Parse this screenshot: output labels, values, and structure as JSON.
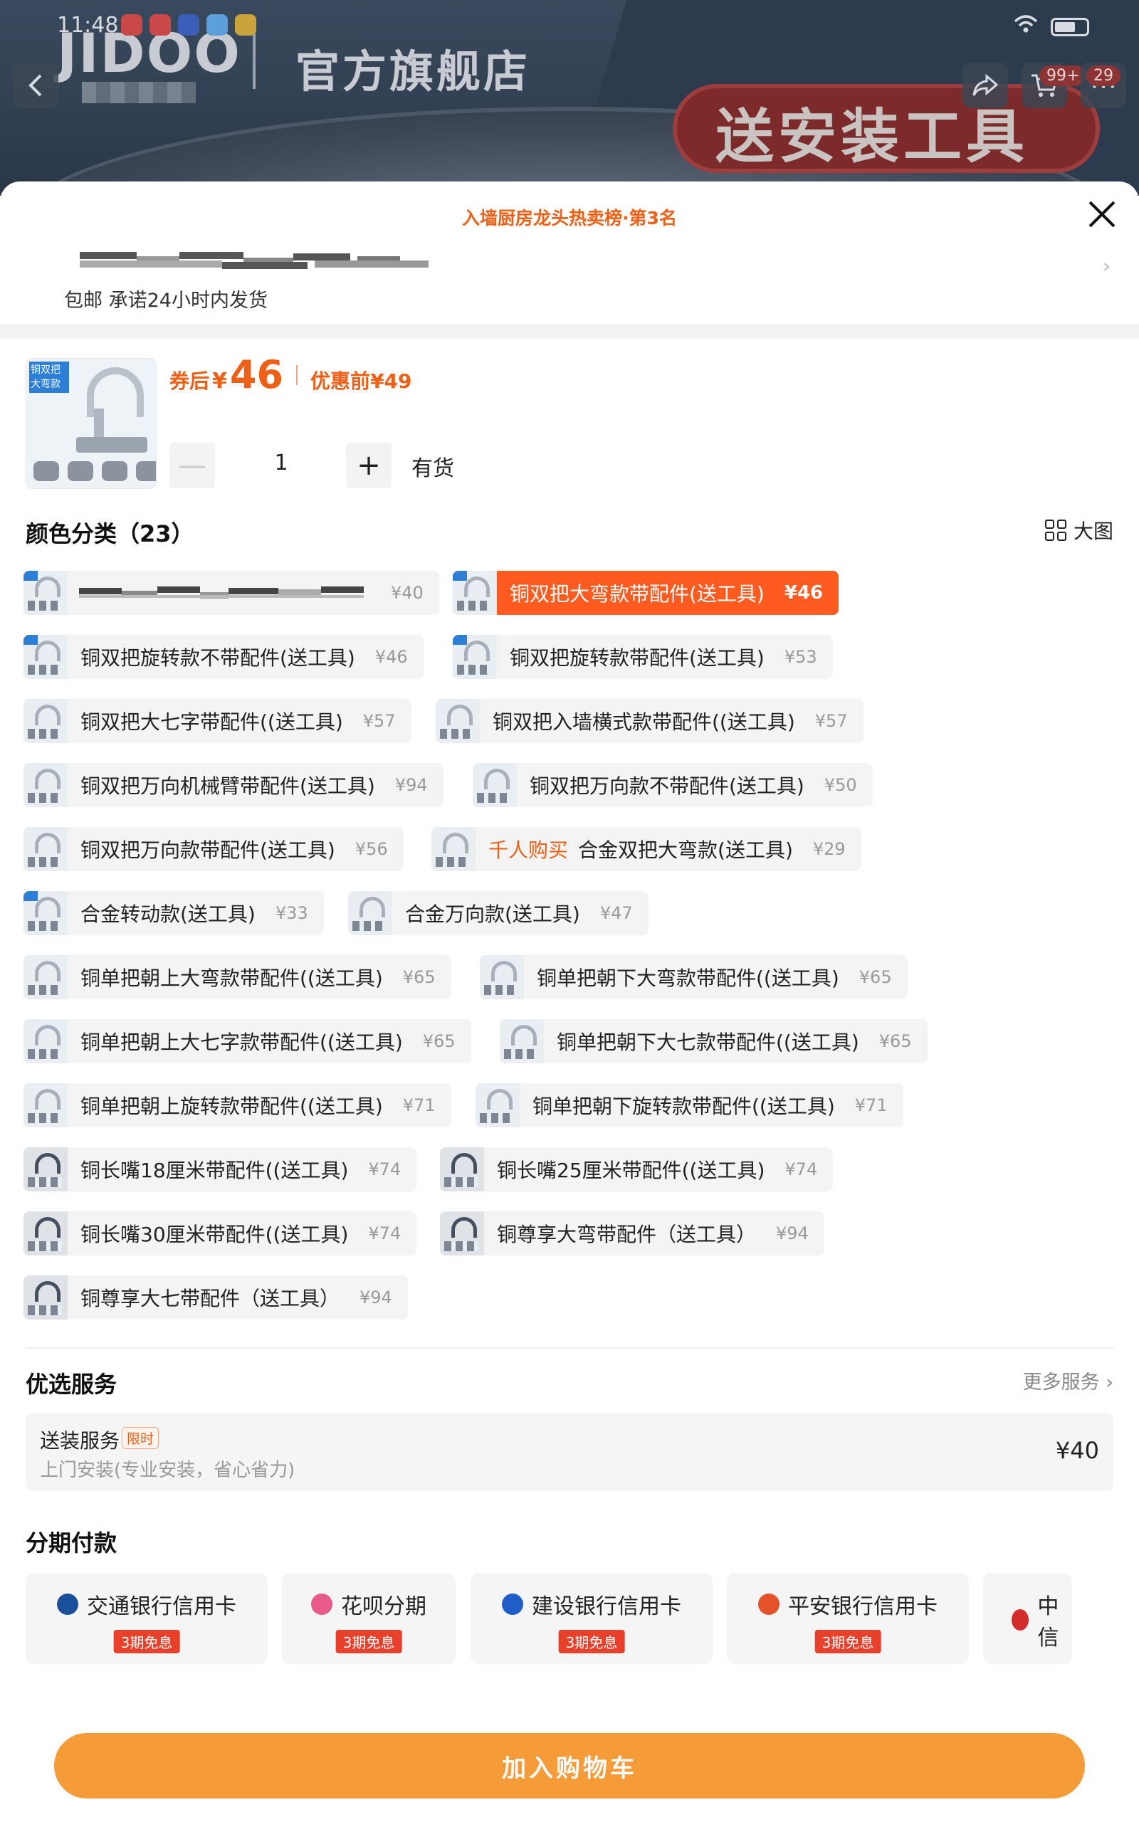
{
  "status_bar": {
    "time": "11:48"
  },
  "banner": {
    "brand": "JIDOO",
    "store_title": "官方旗舰店",
    "promo": "送安装工具",
    "cart_badge": "99+",
    "more_badge": "29"
  },
  "sheet": {
    "hot_title": "入墙厨房龙头热卖榜·第3名",
    "shipping": "包邮 承诺24小时内发货"
  },
  "product": {
    "thumb_tag": "铜双把大弯款",
    "price_label": "券后",
    "currency": "¥",
    "price": "46",
    "before_label": "优惠前",
    "before_price": "¥49",
    "qty": "1",
    "stock": "有货"
  },
  "variants": {
    "title": "颜色分类（23）",
    "bigview_label": "大图",
    "items": [
      {
        "label": "",
        "price": "¥40"
      },
      {
        "label": "铜双把大弯款带配件(送工具)",
        "price": "¥46",
        "selected": true
      },
      {
        "label": "铜双把旋转款不带配件(送工具)",
        "price": "¥46"
      },
      {
        "label": "铜双把旋转款带配件(送工具)",
        "price": "¥53"
      },
      {
        "label": "铜双把大七字带配件((送工具)",
        "price": "¥57"
      },
      {
        "label": "铜双把入墙横式款带配件((送工具)",
        "price": "¥57"
      },
      {
        "label": "铜双把万向机械臂带配件(送工具)",
        "price": "¥94"
      },
      {
        "label": "铜双把万向款不带配件(送工具)",
        "price": "¥50"
      },
      {
        "label": "铜双把万向款带配件(送工具)",
        "price": "¥56"
      },
      {
        "hot": "千人购买",
        "label": "合金双把大弯款(送工具)",
        "price": "¥29"
      },
      {
        "label": "合金转动款(送工具)",
        "price": "¥33"
      },
      {
        "label": "合金万向款(送工具)",
        "price": "¥47"
      },
      {
        "label": "铜单把朝上大弯款带配件((送工具)",
        "price": "¥65"
      },
      {
        "label": "铜单把朝下大弯款带配件((送工具)",
        "price": "¥65"
      },
      {
        "label": "铜单把朝上大七字款带配件((送工具)",
        "price": "¥65"
      },
      {
        "label": "铜单把朝下大七款带配件((送工具)",
        "price": "¥65"
      },
      {
        "label": "铜单把朝上旋转款带配件((送工具)",
        "price": "¥71"
      },
      {
        "label": "铜单把朝下旋转款带配件((送工具)",
        "price": "¥71"
      },
      {
        "label": "铜长嘴18厘米带配件((送工具)",
        "price": "¥74"
      },
      {
        "label": "铜长嘴25厘米带配件((送工具)",
        "price": "¥74"
      },
      {
        "label": "铜长嘴30厘米带配件((送工具)",
        "price": "¥74"
      },
      {
        "label": "铜尊享大弯带配件（送工具）",
        "price": "¥94"
      },
      {
        "label": "铜尊享大七带配件（送工具）",
        "price": "¥94"
      }
    ]
  },
  "services": {
    "title": "优选服务",
    "more": "更多服务",
    "item": {
      "name": "送装服务",
      "tag": "限时",
      "desc": "上门安装(专业安装，省心省力)",
      "price": "¥40"
    }
  },
  "installments": {
    "title": "分期付款",
    "items": [
      {
        "name": "交通银行信用卡",
        "badge": "3期免息",
        "color": "#1a4f9c"
      },
      {
        "name": "花呗分期",
        "badge": "3期免息",
        "color": "#e85a8c"
      },
      {
        "name": "建设银行信用卡",
        "badge": "3期免息",
        "color": "#1f5ec9"
      },
      {
        "name": "平安银行信用卡",
        "badge": "3期免息",
        "color": "#e5532a"
      },
      {
        "name": "中信",
        "badge": "",
        "color": "#d42b2b"
      }
    ]
  },
  "add_to_cart": "加入购物车",
  "colors": {
    "accent": "#ff5a1f",
    "cart_button": "#f59b38",
    "installment_badge": "#e8402a"
  }
}
